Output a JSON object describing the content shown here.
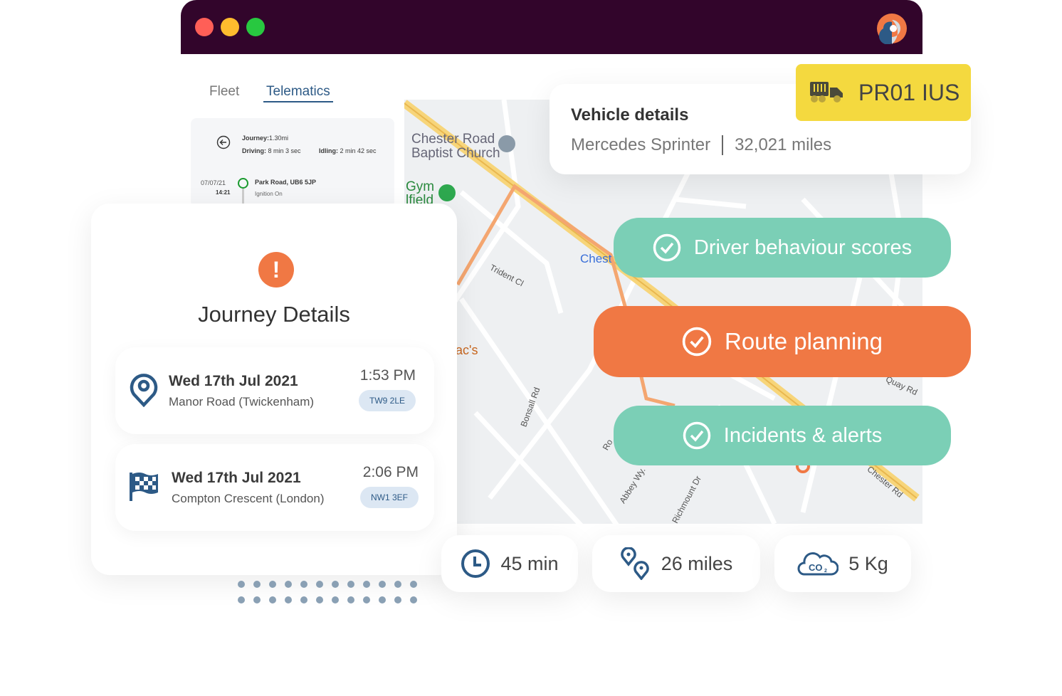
{
  "window": {
    "controls": [
      "close",
      "minimize",
      "maximize"
    ],
    "colors": {
      "close": "#ff5f57",
      "minimize": "#febc2e",
      "maximize": "#28c840",
      "titlebar": "#32052b"
    }
  },
  "tabs": [
    {
      "label": "Fleet",
      "active": false
    },
    {
      "label": "Telematics",
      "active": true
    }
  ],
  "summary": {
    "journey_label": "Journey:",
    "journey_value": "1.30mi",
    "driving_label": "Driving:",
    "driving_value": "8 min 3 sec",
    "idling_label": "Idling:",
    "idling_value": "2 min 42 sec",
    "event_date": "07/07/21",
    "event_time": "14:21",
    "event_place": "Park Road, UB6 5JP",
    "event_status": "Ignition On"
  },
  "map": {
    "labels": [
      "Chester Road",
      "Baptist Church",
      "Gym",
      "lfield",
      "Chest",
      "Trident Cl",
      "ac's",
      "Bonsall Rd",
      "Abbey Wy.",
      "Richmount Dr",
      "Chester Rd",
      "Quay Rd",
      "Ro"
    ]
  },
  "vehicle": {
    "title": "Vehicle details",
    "model": "Mercedes Sprinter",
    "mileage": "32,021 miles",
    "plate": "PR01 IUS",
    "plate_color": "#f4d93f"
  },
  "journey": {
    "title": "Journey Details",
    "start": {
      "date": "Wed 17th Jul 2021",
      "place": "Manor Road (Twickenham)",
      "time": "1:53 PM",
      "postcode": "TW9 2LE"
    },
    "end": {
      "date": "Wed 17th Jul 2021",
      "place": "Compton Crescent (London)",
      "time": "2:06 PM",
      "postcode": "NW1 3EF"
    }
  },
  "features": [
    {
      "label": "Driver behaviour scores",
      "color": "#7bcfb6"
    },
    {
      "label": "Route planning",
      "color": "#f07844"
    },
    {
      "label": "Incidents & alerts",
      "color": "#7bcfb6"
    }
  ],
  "stats": {
    "duration": "45 min",
    "distance": "26 miles",
    "co2": "5 Kg"
  }
}
